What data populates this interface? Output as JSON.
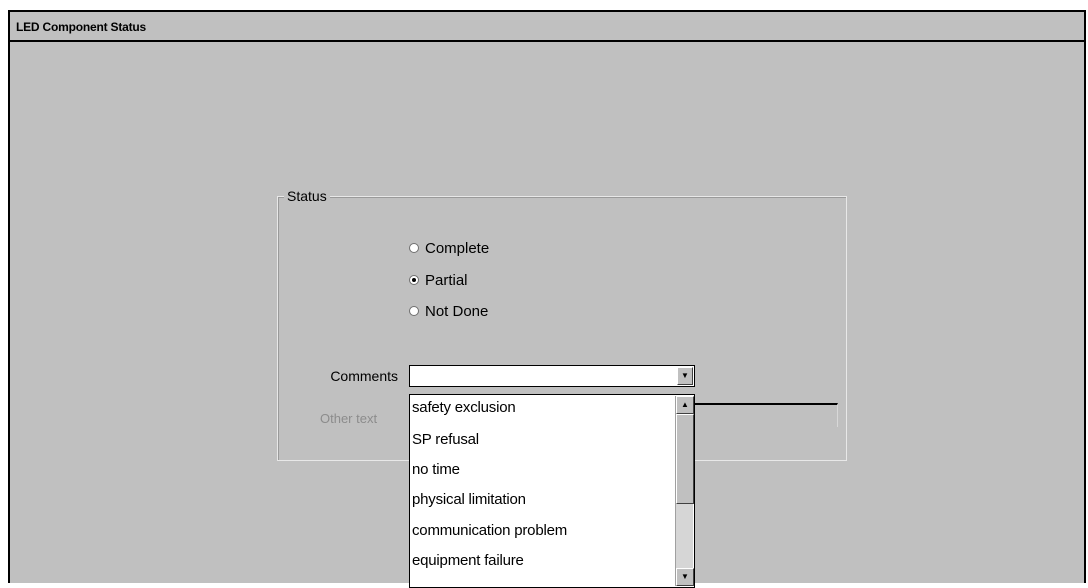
{
  "window": {
    "title": "LED Component Status"
  },
  "status_group": {
    "legend": "Status",
    "options": [
      {
        "label": "Complete",
        "selected": false
      },
      {
        "label": "Partial",
        "selected": true
      },
      {
        "label": "Not Done",
        "selected": false
      }
    ]
  },
  "comments": {
    "label": "Comments",
    "value": "",
    "dropdown_open": true,
    "options": [
      "safety exclusion",
      "SP refusal",
      "no time",
      "physical limitation",
      "communication problem",
      "equipment failure"
    ]
  },
  "other_text": {
    "label": "Other text",
    "value": ""
  },
  "icons": {
    "radio": "radio-button-icon",
    "dropdown": "chevron-down-icon",
    "scroll_up": "scroll-up-arrow-icon",
    "scroll_down": "scroll-down-arrow-icon"
  },
  "colors": {
    "window_background": "#c0c0c0",
    "list_background": "#ffffff",
    "disabled_text": "#8c8c8c"
  }
}
